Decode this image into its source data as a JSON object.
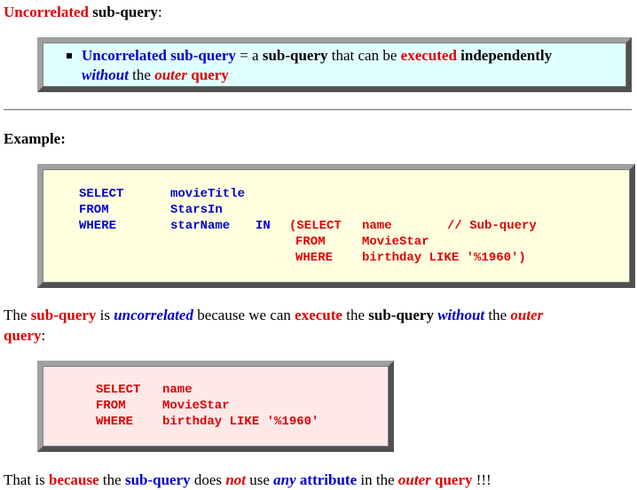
{
  "heading": {
    "word1": "Uncorrelated",
    "word2": "sub-query",
    "colon": ":"
  },
  "definition": {
    "t1": "Uncorrelated sub-query",
    "t2": " = a ",
    "t3": "sub-query",
    "t4": " that can be ",
    "t5": "executed",
    "t6": " independently",
    "t7": "without",
    "t8": " the ",
    "t9": "outer",
    "t10": " query"
  },
  "example_label": "Example:",
  "outer_query": {
    "r1": [
      "SELECT",
      "movieTitle"
    ],
    "r2": [
      "FROM",
      "StarsIn"
    ],
    "r3": [
      "WHERE",
      "starName",
      "IN"
    ],
    "sub_r1": [
      "(SELECT",
      "name",
      "// Sub-query"
    ],
    "sub_r2": [
      "FROM",
      "MovieStar"
    ],
    "sub_r3": [
      "WHERE",
      "birthday LIKE '%1960')"
    ]
  },
  "explanation": {
    "t1": "The ",
    "t2": "sub-query",
    "t3": " is ",
    "t4": "uncorrelated",
    "t5": " because we can ",
    "t6": "execute",
    "t7": " the ",
    "t8": "sub-query",
    "t9": " ",
    "t10": "without",
    "t11": " the ",
    "t12": "outer",
    "t13": "query",
    "t14": ":"
  },
  "sub_query": {
    "r1": [
      "SELECT",
      "name"
    ],
    "r2": [
      "FROM",
      "MovieStar"
    ],
    "r3": [
      "WHERE",
      "birthday LIKE '%1960'"
    ]
  },
  "conclusion": {
    "t1": "That is ",
    "t2": "because",
    "t3": " the ",
    "t4": "sub-query",
    "t5": " does ",
    "t6": "not",
    "t7": " use ",
    "t8": "any",
    "t9": " ",
    "t10": "attribute",
    "t11": " in the ",
    "t12": "outer",
    "t13": " query",
    "t14": " !!!"
  },
  "colors": {
    "accent_red": "#e00000",
    "accent_blue": "#0000cc",
    "box1_bg": "#e0ffff",
    "box2_bg": "#ffffe0",
    "box3_bg": "#ffe8e8"
  }
}
